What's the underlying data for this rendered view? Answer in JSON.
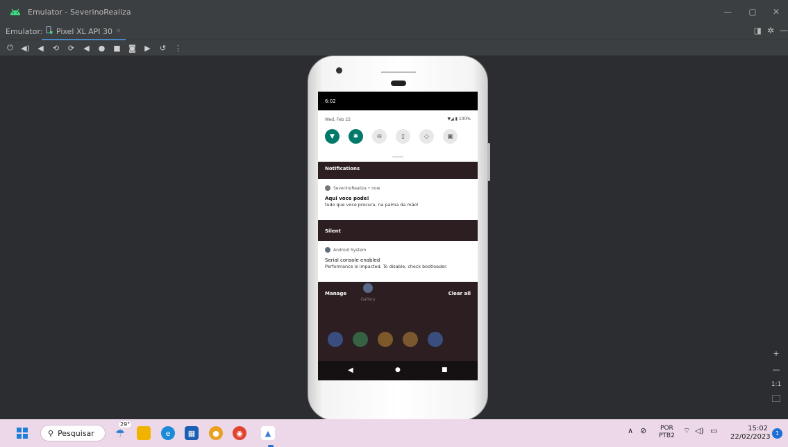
{
  "window": {
    "title": "Emulator - SeverinoRealiza",
    "controls": [
      "—",
      "▢",
      "✕"
    ]
  },
  "tabbar": {
    "label": "Emulator:",
    "tab_label": "Pixel XL API 30",
    "tab_close": "×"
  },
  "toolbar": {
    "icons": [
      "power-icon",
      "volume-up-icon",
      "volume-down-icon",
      "rotate-left-icon",
      "rotate-right-icon",
      "back-icon",
      "home-icon",
      "overview-icon",
      "screenshot-icon",
      "screenrecord-icon",
      "snapshot-icon",
      "more-icon"
    ]
  },
  "device": {
    "status_time": "6:02",
    "qs_date": "Wed, Feb 22",
    "qs_status": "▼◢ ▮ 100%",
    "tiles": [
      {
        "name": "wifi",
        "glyph": "▼",
        "on": true
      },
      {
        "name": "bluetooth",
        "glyph": "✱",
        "on": true
      },
      {
        "name": "dnd",
        "glyph": "⊖",
        "on": false
      },
      {
        "name": "flashlight",
        "glyph": "▯",
        "on": false
      },
      {
        "name": "autorotate",
        "glyph": "◇",
        "on": false
      },
      {
        "name": "battery-saver",
        "glyph": "▣",
        "on": false
      }
    ],
    "notifications_header": "Notifications",
    "notif1": {
      "app": "SeverinoRealiza • now",
      "title": "Aqui voce pode!",
      "body": "tudo que voce procura, na palma da mão!"
    },
    "silent_header": "Silent",
    "notif2": {
      "app": "Android System",
      "title": "Serial console enabled",
      "body": "Performance is impacted. To disable, check bootloader."
    },
    "manage": "Manage",
    "clear_all": "Clear all",
    "gallery_label": "Gallery",
    "nav": {
      "back": "◀",
      "home": "●",
      "recents": "■"
    }
  },
  "zoom": {
    "plus": "+",
    "minus": "—",
    "one_to_one": "1:1"
  },
  "taskbar": {
    "search_label": "Pesquisar",
    "weather_temp": "29°",
    "lang_top": "POR",
    "lang_bottom": "PTB2",
    "time": "15:02",
    "date": "22/02/2023",
    "notif_count": "1"
  }
}
